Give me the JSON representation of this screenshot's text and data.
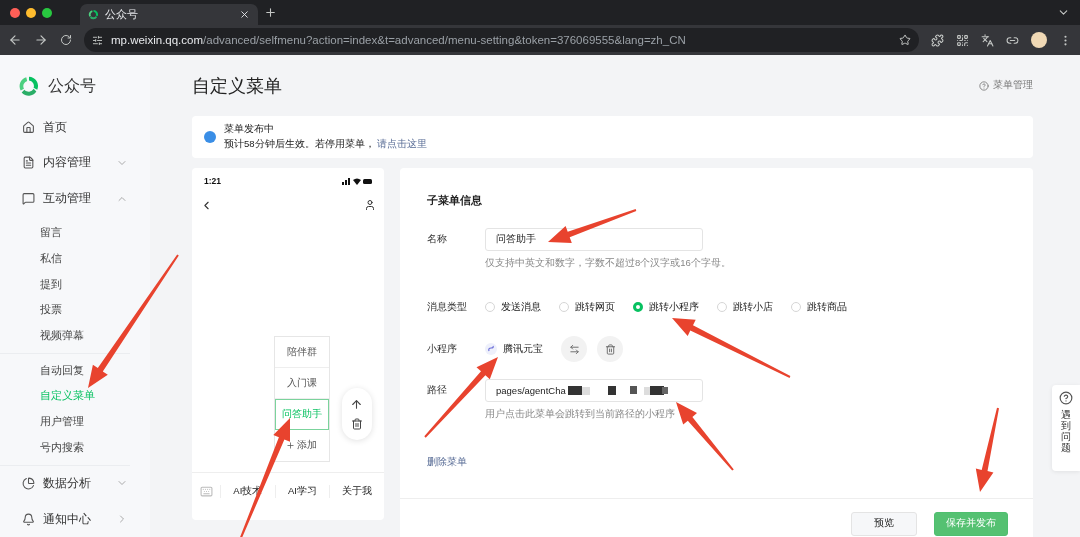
{
  "browser": {
    "tab_title": "公众号",
    "url_host": "mp.weixin.qq.com",
    "url_path": "/advanced/selfmenu?action=index&t=advanced/menu-setting&token=376069555&lang=zh_CN"
  },
  "sidebar": {
    "brand": "公众号",
    "items": [
      {
        "label": "首页",
        "kind": "page"
      },
      {
        "label": "内容管理",
        "kind": "group",
        "expanded": false
      },
      {
        "label": "互动管理",
        "kind": "group",
        "expanded": true,
        "groups": [
          {
            "items": [
              {
                "label": "留言",
                "selected": false
              },
              {
                "label": "私信",
                "selected": false
              },
              {
                "label": "提到",
                "selected": false
              },
              {
                "label": "投票",
                "selected": false
              },
              {
                "label": "视频弹幕",
                "selected": false
              }
            ]
          },
          {
            "items": [
              {
                "label": "自动回复",
                "selected": false
              },
              {
                "label": "自定义菜单",
                "selected": true
              },
              {
                "label": "用户管理",
                "selected": false
              },
              {
                "label": "号内搜索",
                "selected": false
              }
            ]
          }
        ]
      },
      {
        "label": "数据分析",
        "kind": "group",
        "expanded": false
      },
      {
        "label": "通知中心",
        "kind": "link"
      }
    ]
  },
  "page": {
    "title": "自定义菜单",
    "help_link": "菜单管理"
  },
  "notice": {
    "title": "菜单发布中",
    "text": "预计58分钟后生效。若停用菜单，",
    "link": "请点击这里"
  },
  "phone": {
    "time": "1:21",
    "submenu": [
      {
        "label": "陪伴群",
        "selected": false
      },
      {
        "label": "入门课",
        "selected": false
      },
      {
        "label": "问答助手",
        "selected": true
      }
    ],
    "add_label": "添加",
    "menu": [
      "AI技术",
      "AI学习",
      "关于我"
    ]
  },
  "form": {
    "title": "子菜单信息",
    "name_label": "名称",
    "name_value": "问答助手",
    "name_hint": "仅支持中英文和数字，字数不超过8个汉字或16个字母。",
    "type_label": "消息类型",
    "types": [
      {
        "label": "发送消息",
        "selected": false
      },
      {
        "label": "跳转网页",
        "selected": false
      },
      {
        "label": "跳转小程序",
        "selected": true
      },
      {
        "label": "跳转小店",
        "selected": false
      },
      {
        "label": "跳转商品",
        "selected": false
      }
    ],
    "miniprogram_label": "小程序",
    "miniprogram_name": "腾讯元宝",
    "path_label": "路径",
    "path_value": "pages/agentCha",
    "path_hint": "用户点击此菜单会跳转到当前路径的小程序",
    "delete_link": "删除菜单",
    "buttons": [
      {
        "label": "预览",
        "kind": "secondary"
      },
      {
        "label": "保存并发布",
        "kind": "primary"
      }
    ]
  },
  "help_tab": "遇到问题"
}
